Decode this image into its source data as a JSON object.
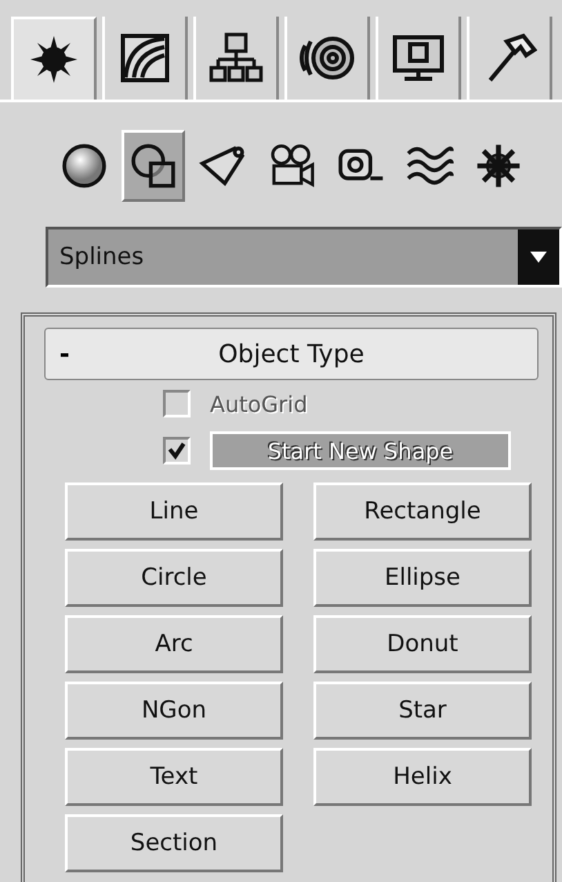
{
  "tabs": [
    {
      "kind": "create",
      "selected": true
    },
    {
      "kind": "modify",
      "selected": false
    },
    {
      "kind": "hierarchy",
      "selected": false
    },
    {
      "kind": "motion",
      "selected": false
    },
    {
      "kind": "display",
      "selected": false
    },
    {
      "kind": "utilities",
      "selected": false
    }
  ],
  "categories": [
    {
      "kind": "geometry",
      "selected": false
    },
    {
      "kind": "shapes",
      "selected": true
    },
    {
      "kind": "lights",
      "selected": false
    },
    {
      "kind": "cameras",
      "selected": false
    },
    {
      "kind": "helpers",
      "selected": false
    },
    {
      "kind": "spacewarps",
      "selected": false
    },
    {
      "kind": "systems",
      "selected": false
    }
  ],
  "dropdown": {
    "value": "Splines"
  },
  "rollout": {
    "collapse_sign": "-",
    "title": "Object Type",
    "options": [
      {
        "kind": "plain",
        "label": "AutoGrid",
        "checked": false,
        "disabled": true
      },
      {
        "kind": "button",
        "label": "Start New Shape",
        "checked": true,
        "disabled": false
      }
    ],
    "buttons": [
      "Line",
      "Rectangle",
      "Circle",
      "Ellipse",
      "Arc",
      "Donut",
      "NGon",
      "Star",
      "Text",
      "Helix",
      "Section"
    ]
  }
}
